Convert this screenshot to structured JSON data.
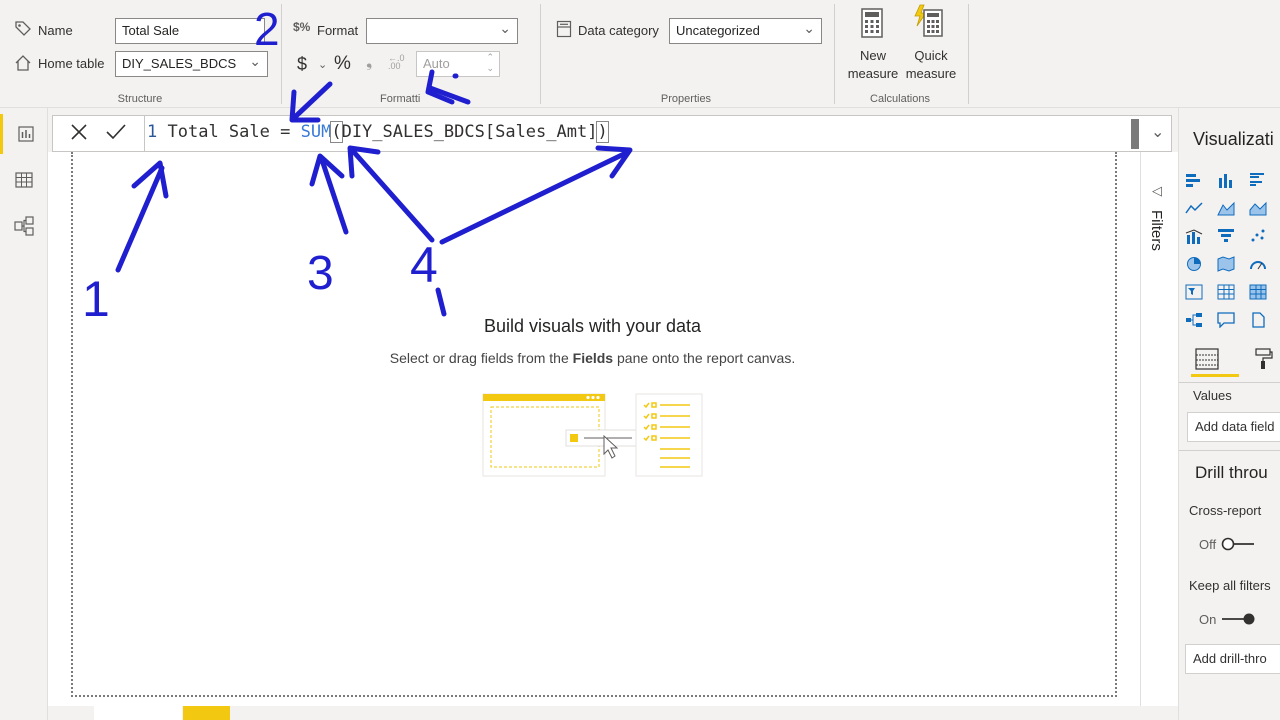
{
  "ribbon": {
    "structure": {
      "name_label": "Name",
      "name_value": "Total Sale",
      "home_table_label": "Home table",
      "home_table_value": "DIY_SALES_BDCS",
      "group_label": "Structure"
    },
    "formatting": {
      "format_label": "Format",
      "format_value": "",
      "currency_symbol": "$",
      "percent_symbol": "%",
      "decimals_value": "Auto",
      "group_label": "Formatti"
    },
    "properties": {
      "data_category_label": "Data category",
      "data_category_value": "Uncategorized",
      "group_label": "Properties"
    },
    "calculations": {
      "new_measure_line1": "New",
      "new_measure_line2": "measure",
      "quick_measure_line1": "Quick",
      "quick_measure_line2": "measure",
      "group_label": "Calculations"
    }
  },
  "formula_bar": {
    "line_number": "1",
    "measure_name": "Total Sale",
    "equals": "=",
    "function": "SUM",
    "open_paren": "(",
    "column_ref": "DIY_SALES_BDCS[Sales_Amt]",
    "close_paren": ")"
  },
  "canvas": {
    "empty_title": "Build visuals with your data",
    "empty_sub_prefix": "Select or drag fields from the ",
    "empty_sub_bold": "Fields",
    "empty_sub_suffix": " pane onto the report canvas."
  },
  "filters": {
    "label": "Filters"
  },
  "visualizations": {
    "title": "Visualizati",
    "values_label": "Values",
    "add_data_field": "Add data field",
    "drill_through_title": "Drill throu",
    "cross_report_label": "Cross-report",
    "cross_report_state": "Off",
    "keep_all_filters_label": "Keep all filters",
    "keep_all_filters_state": "On",
    "add_drill_through": "Add drill-thro"
  },
  "annotations": {
    "n1": "1",
    "n2": "2",
    "n3": "3",
    "n4": "4"
  },
  "colors": {
    "accent": "#f2c811",
    "annotation": "#1f1fcf",
    "viz_icon": "#0f6cbd"
  }
}
